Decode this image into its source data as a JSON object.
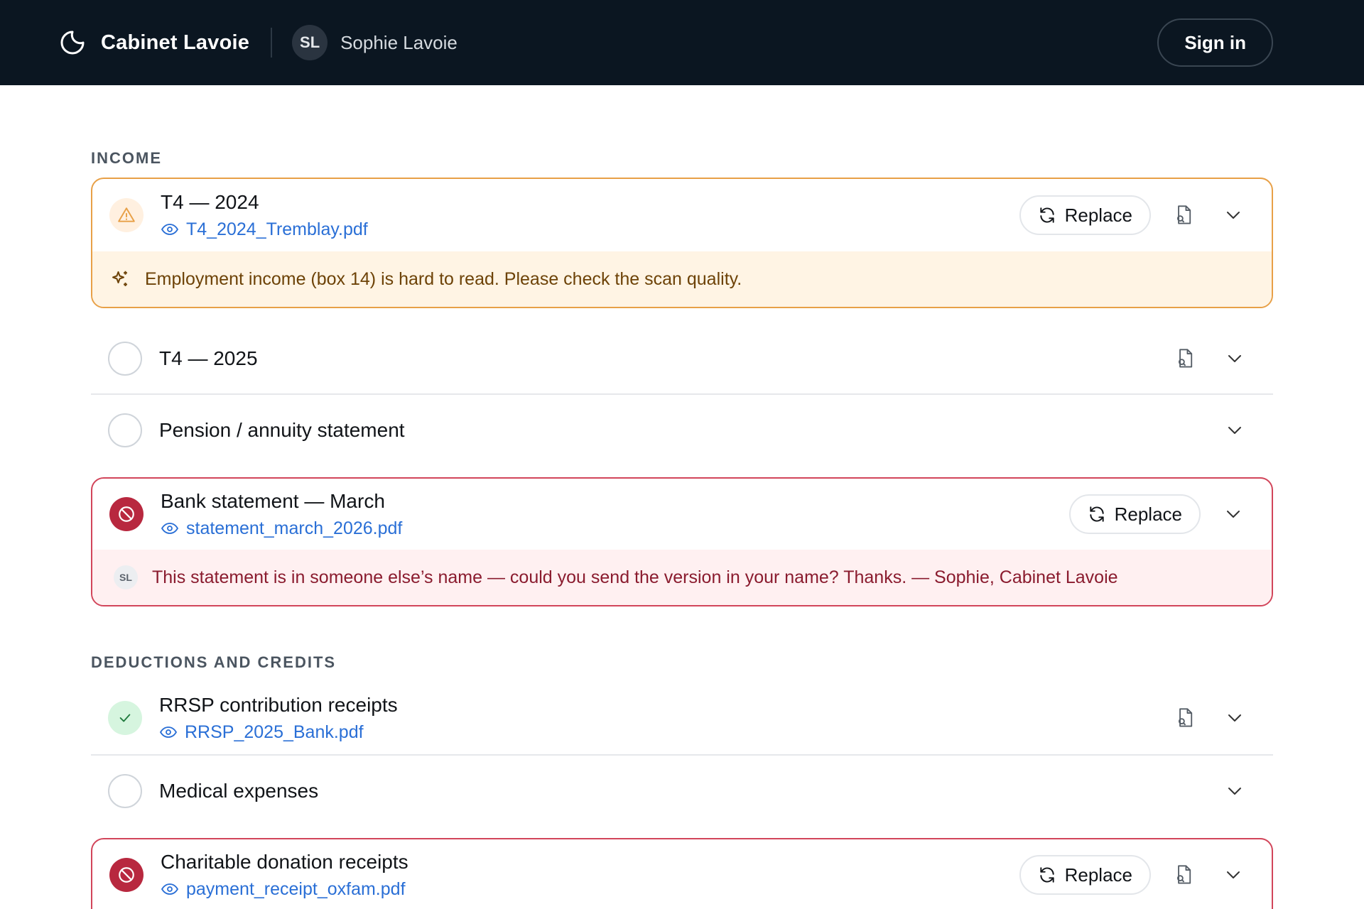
{
  "header": {
    "brand": "Cabinet Lavoie",
    "brand_icon": "moon-icon",
    "user_initials": "SL",
    "user_name": "Sophie Lavoie",
    "signin_label": "Sign in"
  },
  "colors": {
    "header_bg": "#0b1621",
    "warning": "#e8a047",
    "error": "#b8283f",
    "success": "#d6f5df",
    "link": "#2a6fd6"
  },
  "sections": [
    {
      "label": "INCOME",
      "items": [
        {
          "title": "T4 — 2024",
          "status": "warning",
          "file": "T4_2024_Tremblay.pdf",
          "replace_label": "Replace",
          "note": "Employment income (box 14) is hard to read. Please check the scan quality."
        },
        {
          "title": "T4 — 2025",
          "status": "empty"
        },
        {
          "title": "Pension / annuity statement",
          "status": "empty"
        },
        {
          "title": "Bank statement — March",
          "status": "rejected",
          "file": "statement_march_2026.pdf",
          "replace_label": "Replace",
          "note_author_initials": "SL",
          "note": "This statement is in someone else’s name — could you send the version in your name? Thanks. — Sophie, Cabinet Lavoie"
        }
      ]
    },
    {
      "label": "DEDUCTIONS AND CREDITS",
      "items": [
        {
          "title": "RRSP contribution receipts",
          "status": "complete",
          "file": "RRSP_2025_Bank.pdf"
        },
        {
          "title": "Medical expenses",
          "status": "empty"
        },
        {
          "title": "Charitable donation receipts",
          "status": "rejected",
          "file": "payment_receipt_oxfam.pdf",
          "replace_label": "Replace"
        }
      ]
    }
  ]
}
